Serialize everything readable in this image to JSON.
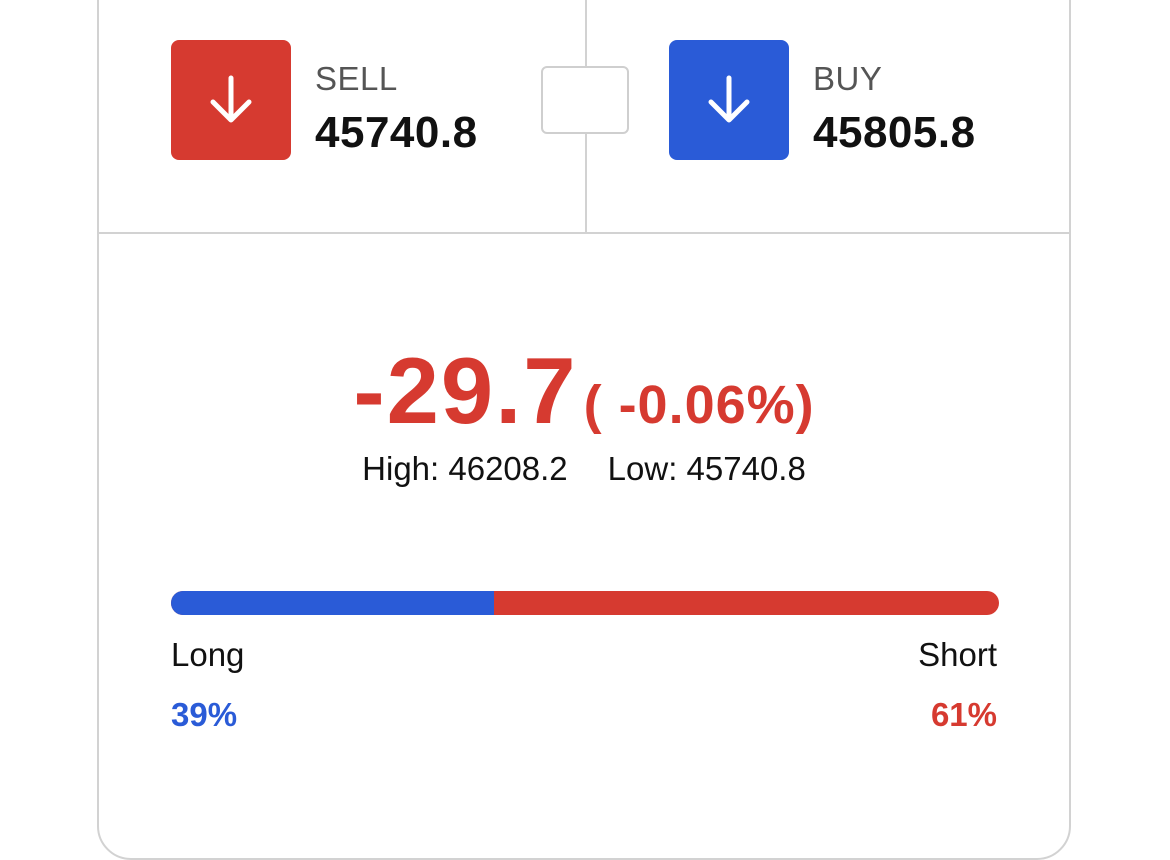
{
  "colors": {
    "sell": "#d63a30",
    "buy": "#2a5bd7",
    "negative": "#d63a30",
    "long": "#2a5bd7",
    "short": "#d63a30",
    "border": "#d2d2d2"
  },
  "sell": {
    "label": "SELL",
    "price": "45740.8",
    "icon": "arrow-down-icon"
  },
  "buy": {
    "label": "BUY",
    "price": "45805.8",
    "icon": "arrow-down-icon"
  },
  "change": {
    "value": "-29.7",
    "percent": "( -0.06%)"
  },
  "range": {
    "high": "High: 46208.2",
    "low": "Low: 45740.8"
  },
  "sentiment": {
    "long_label": "Long",
    "short_label": "Short",
    "long_percent": "39%",
    "short_percent": "61%",
    "long_fraction": 0.39
  }
}
